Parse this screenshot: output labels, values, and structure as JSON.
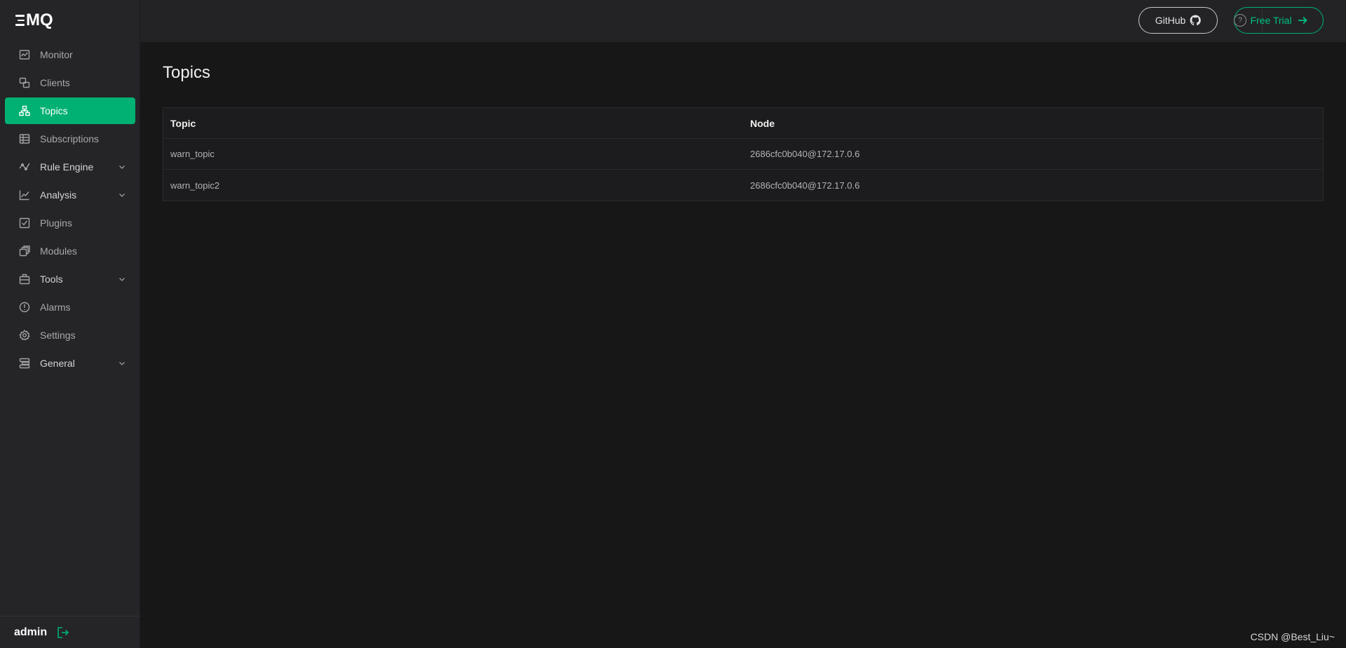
{
  "app": {
    "logo_text": "MQ"
  },
  "sidebar": {
    "items": [
      {
        "label": "Monitor",
        "icon": "monitor-icon",
        "active": false,
        "has_sub": false
      },
      {
        "label": "Clients",
        "icon": "clients-icon",
        "active": false,
        "has_sub": false
      },
      {
        "label": "Topics",
        "icon": "topics-icon",
        "active": true,
        "has_sub": false
      },
      {
        "label": "Subscriptions",
        "icon": "subscriptions-icon",
        "active": false,
        "has_sub": false
      },
      {
        "label": "Rule Engine",
        "icon": "rule-engine-icon",
        "active": false,
        "has_sub": true
      },
      {
        "label": "Analysis",
        "icon": "analysis-icon",
        "active": false,
        "has_sub": true
      },
      {
        "label": "Plugins",
        "icon": "plugins-icon",
        "active": false,
        "has_sub": false
      },
      {
        "label": "Modules",
        "icon": "modules-icon",
        "active": false,
        "has_sub": false
      },
      {
        "label": "Tools",
        "icon": "tools-icon",
        "active": false,
        "has_sub": true
      },
      {
        "label": "Alarms",
        "icon": "alarms-icon",
        "active": false,
        "has_sub": false
      },
      {
        "label": "Settings",
        "icon": "settings-icon",
        "active": false,
        "has_sub": false
      },
      {
        "label": "General",
        "icon": "general-icon",
        "active": false,
        "has_sub": true
      }
    ],
    "user": "admin"
  },
  "header": {
    "help_icon": "?",
    "github_label": "GitHub",
    "trial_label": "Free Trial"
  },
  "main": {
    "title": "Topics",
    "columns": [
      "Topic",
      "Node"
    ],
    "rows": [
      [
        "warn_topic",
        "2686cfc0b040@172.17.0.6"
      ],
      [
        "warn_topic2",
        "2686cfc0b040@172.17.0.6"
      ]
    ]
  },
  "watermark": "CSDN @Best_Liu~",
  "colors": {
    "accent": "#00b173",
    "sidebar_bg": "#252528",
    "page_bg": "#171718"
  }
}
